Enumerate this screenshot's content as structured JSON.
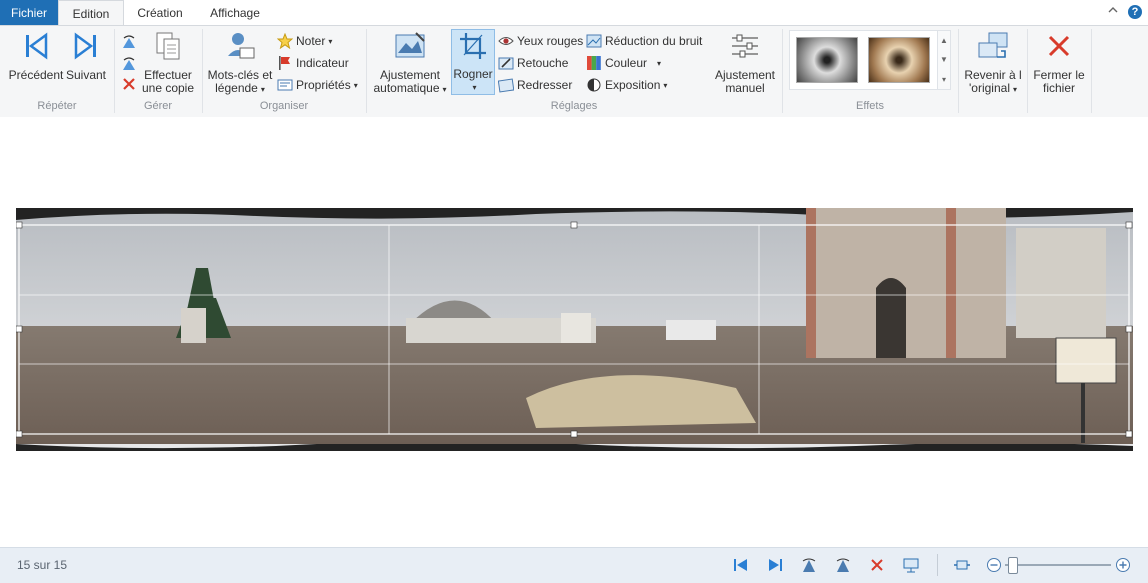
{
  "tabs": {
    "file": "Fichier",
    "edition": "Edition",
    "creation": "Création",
    "view": "Affichage"
  },
  "help": "?",
  "groups": {
    "repeter": "Répéter",
    "gerer": "Gérer",
    "organiser": "Organiser",
    "reglages": "Réglages",
    "effets": "Effets"
  },
  "buttons": {
    "previous": "Précédent",
    "next": "Suivant",
    "copy_line1": "Effectuer",
    "copy_line2": "une copie",
    "keywords_line1": "Mots-clés et",
    "keywords_line2": "légende",
    "rate": "Noter",
    "flag": "Indicateur",
    "properties": "Propriétés",
    "auto_adjust_line1": "Ajustement",
    "auto_adjust_line2": "automatique",
    "crop": "Rogner",
    "red_eye": "Yeux rouges",
    "retouch": "Retouche",
    "straighten": "Redresser",
    "noise": "Réduction du bruit",
    "color": "Couleur",
    "exposure": "Exposition",
    "manual_line1": "Ajustement",
    "manual_line2": "manuel",
    "revert_line1": "Revenir à l",
    "revert_line2": "'original",
    "close_line1": "Fermer le",
    "close_line2": "fichier"
  },
  "status": {
    "count": "15 sur 15"
  },
  "colors": {
    "accent": "#1f6fb5",
    "ribbon": "#f5f6f7",
    "status": "#e8eef5",
    "delete_red": "#d83b2b"
  }
}
